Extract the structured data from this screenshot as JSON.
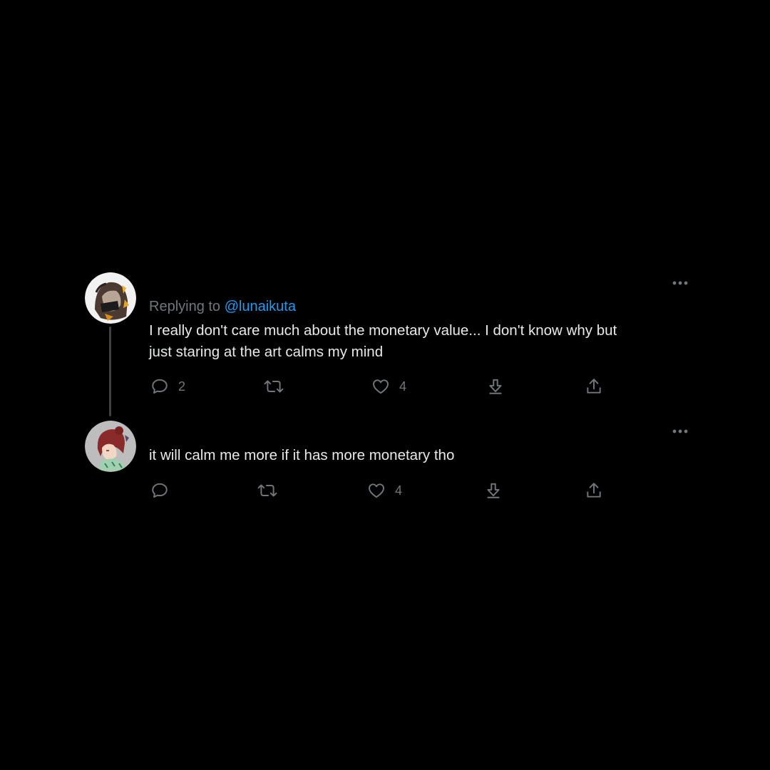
{
  "thread": {
    "tweets": [
      {
        "avatar_icon": "avatar-anime-character-dark-hair",
        "replying_prefix": "Replying to",
        "replying_handle": "@lunaikuta",
        "text_lines": [
          "I really don't care much about the monetary value... I don't know why but",
          "just staring at the art calms my mind"
        ],
        "actions": {
          "reply_count": "2",
          "retweet_count": "",
          "like_count": "4"
        }
      },
      {
        "avatar_icon": "avatar-anime-character-red-hair",
        "text_lines": [
          "it will calm me more if it has more monetary tho"
        ],
        "actions": {
          "reply_count": "",
          "retweet_count": "",
          "like_count": "4"
        }
      }
    ]
  },
  "icons": {
    "more": "more-horizontal-icon",
    "reply": "reply-bubble-icon",
    "retweet": "retweet-icon",
    "like": "heart-icon",
    "download": "download-arrow-icon",
    "share": "share-upload-icon"
  },
  "colors": {
    "background": "#000000",
    "text": "#e7e9ea",
    "secondary_text": "#71767b",
    "mention": "#1d9bf0",
    "thread_line": "#3e4144"
  }
}
